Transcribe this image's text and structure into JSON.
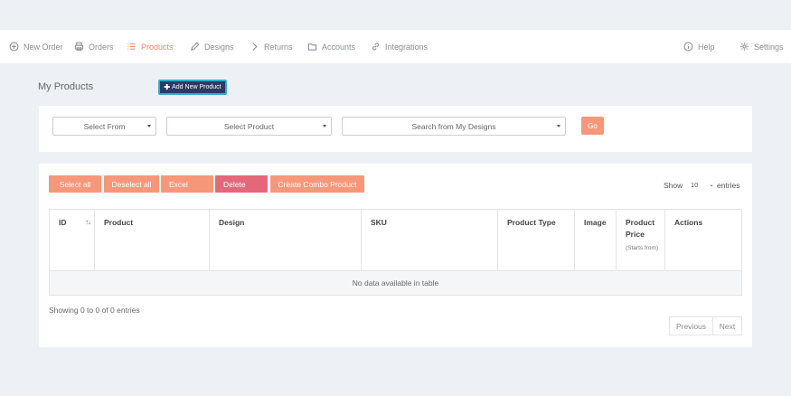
{
  "nav": {
    "new_order": "New Order",
    "orders": "Orders",
    "products": "Products",
    "designs": "Designs",
    "returns": "Returns",
    "accounts": "Accounts",
    "integrations": "Integrations",
    "help": "Help",
    "settings": "Settings",
    "active": "Products",
    "accent_color": "#f0866b"
  },
  "page": {
    "title": "My Products",
    "add_button": "Add New Product"
  },
  "filters": {
    "select_from": "Select From",
    "select_product": "Select Product",
    "search_designs": "Search from My Designs",
    "go": "Go"
  },
  "toolbar": {
    "select_all": "Select all",
    "deselect_all": "Deselect all",
    "excel": "Excel",
    "delete": "Delete",
    "combo": "Create Combo Product",
    "show": "Show",
    "entries_value": "10",
    "entries": "entries"
  },
  "table": {
    "columns": {
      "id": "ID",
      "product": "Product",
      "design": "Design",
      "sku": "SKU",
      "product_type": "Product Type",
      "image": "Image",
      "product_price_1": "Product",
      "product_price_2": "Price",
      "product_price_sub": "(Starts from)",
      "actions": "Actions"
    },
    "empty_message": "No data available in table",
    "rows": []
  },
  "footer": {
    "info": "Showing 0 to 0 of 0 entries",
    "previous": "Previous",
    "next": "Next"
  },
  "colors": {
    "button": "#f7977a",
    "delete": "#e5677a",
    "add_button": "#2b3a67"
  }
}
